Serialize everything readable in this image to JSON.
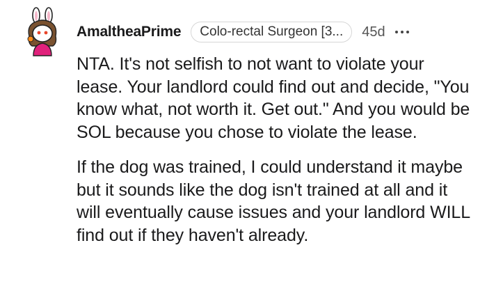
{
  "comment": {
    "author": "AmaltheaPrime",
    "flair": "Colo-rectal Surgeon [3...",
    "age": "45d",
    "avatar_icon": "bunny-ears-avatar-icon",
    "more_icon": "more-options-icon",
    "paragraphs": [
      "NTA. It's not selfish to not want to violate your lease. Your landlord could find out and decide, \"You know what, not worth it. Get out.\" And you would be SOL because you chose to violate the lease.",
      "If the dog was trained, I could understand it maybe but it sounds like the dog isn't trained at all and it will eventually cause issues and your landlord WILL find out if they haven't already."
    ]
  },
  "colors": {
    "text": "#1a1a1b",
    "meta": "#555555",
    "flair_border": "#d6d6d6",
    "avatar_shirt": "#e0217b"
  }
}
